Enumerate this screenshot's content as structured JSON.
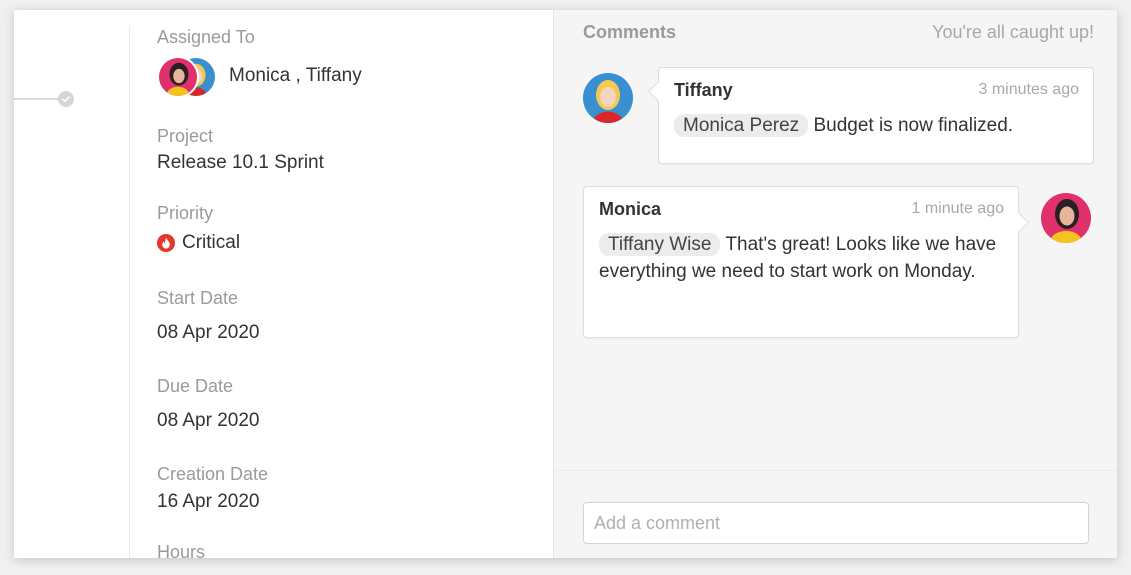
{
  "details": {
    "assigned_to_label": "Assigned To",
    "assignees": "Monica , Tiffany",
    "project_label": "Project",
    "project_value": "Release 10.1 Sprint",
    "priority_label": "Priority",
    "priority_value": "Critical",
    "start_date_label": "Start Date",
    "start_date_value": "08 Apr 2020",
    "due_date_label": "Due Date",
    "due_date_value": "08 Apr 2020",
    "creation_date_label": "Creation Date",
    "creation_date_value": "16 Apr 2020",
    "hours_label": "Hours"
  },
  "comments": {
    "title": "Comments",
    "status": "You're all caught up!",
    "items": [
      {
        "author": "Tiffany",
        "time": "3 minutes ago",
        "mention": "Monica  Perez",
        "text": " Budget is now finalized."
      },
      {
        "author": "Monica",
        "time": "1 minute ago",
        "mention": "Tiffany Wise",
        "text": " That's great! Looks like we have everything we need to start work on Monday."
      }
    ],
    "input_placeholder": "Add a comment"
  },
  "colors": {
    "priority_critical": "#e8352c",
    "panel_background": "#f5f5f5",
    "muted_text": "#9a9a9a"
  },
  "icons": {
    "timeline": "check-circle-icon",
    "priority": "flame-icon"
  }
}
